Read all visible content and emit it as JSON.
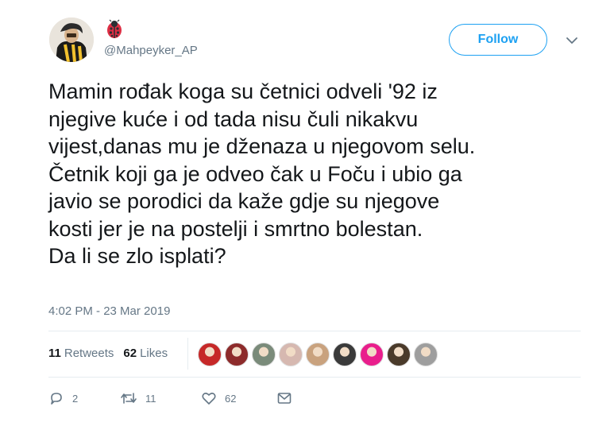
{
  "user": {
    "handle": "@Mahpeyker_AP",
    "name_emoji": "ladybug-icon"
  },
  "header": {
    "follow_label": "Follow",
    "menu_icon": "chevron-down-icon"
  },
  "tweet": {
    "lines": [
      "Mamin rođak koga su četnici odveli '92 iz",
      "njegive kuće i od tada nisu čuli nikakvu",
      "vijest,danas mu je dženaza u njegovom selu.",
      "Četnik koji ga je odveo čak u Foču i ubio ga",
      "javio se porodici da kaže gdje su njegove",
      "kosti jer je na postelji i smrtno bolestan.",
      "Da li se zlo isplati?"
    ],
    "timestamp": "4:02 PM - 23 Mar 2019"
  },
  "stats": {
    "retweets_count": "11",
    "retweets_label": "Retweets",
    "likes_count": "62",
    "likes_label": "Likes"
  },
  "likers": [
    {
      "icon": "captain-america-shield-avatar",
      "color": "#c62828"
    },
    {
      "icon": "flowers-avatar",
      "color": "#8d2b2b"
    },
    {
      "icon": "landscape-avatar",
      "color": "#7a8b7a"
    },
    {
      "icon": "pattern-avatar",
      "color": "#d6b8b0"
    },
    {
      "icon": "face-avatar",
      "color": "#c9a27e"
    },
    {
      "icon": "portrait-avatar",
      "color": "#3a3a3a"
    },
    {
      "icon": "pink-cartoon-avatar",
      "color": "#e91e8c"
    },
    {
      "icon": "bearded-man-avatar",
      "color": "#4a3a2a"
    },
    {
      "icon": "cat-avatar",
      "color": "#9e9e9e"
    }
  ],
  "actions": {
    "replies": "2",
    "retweets": "11",
    "likes": "62"
  },
  "colors": {
    "accent": "#1da1f2",
    "text": "#14171a",
    "secondary": "#657786",
    "border": "#e6ecf0"
  }
}
